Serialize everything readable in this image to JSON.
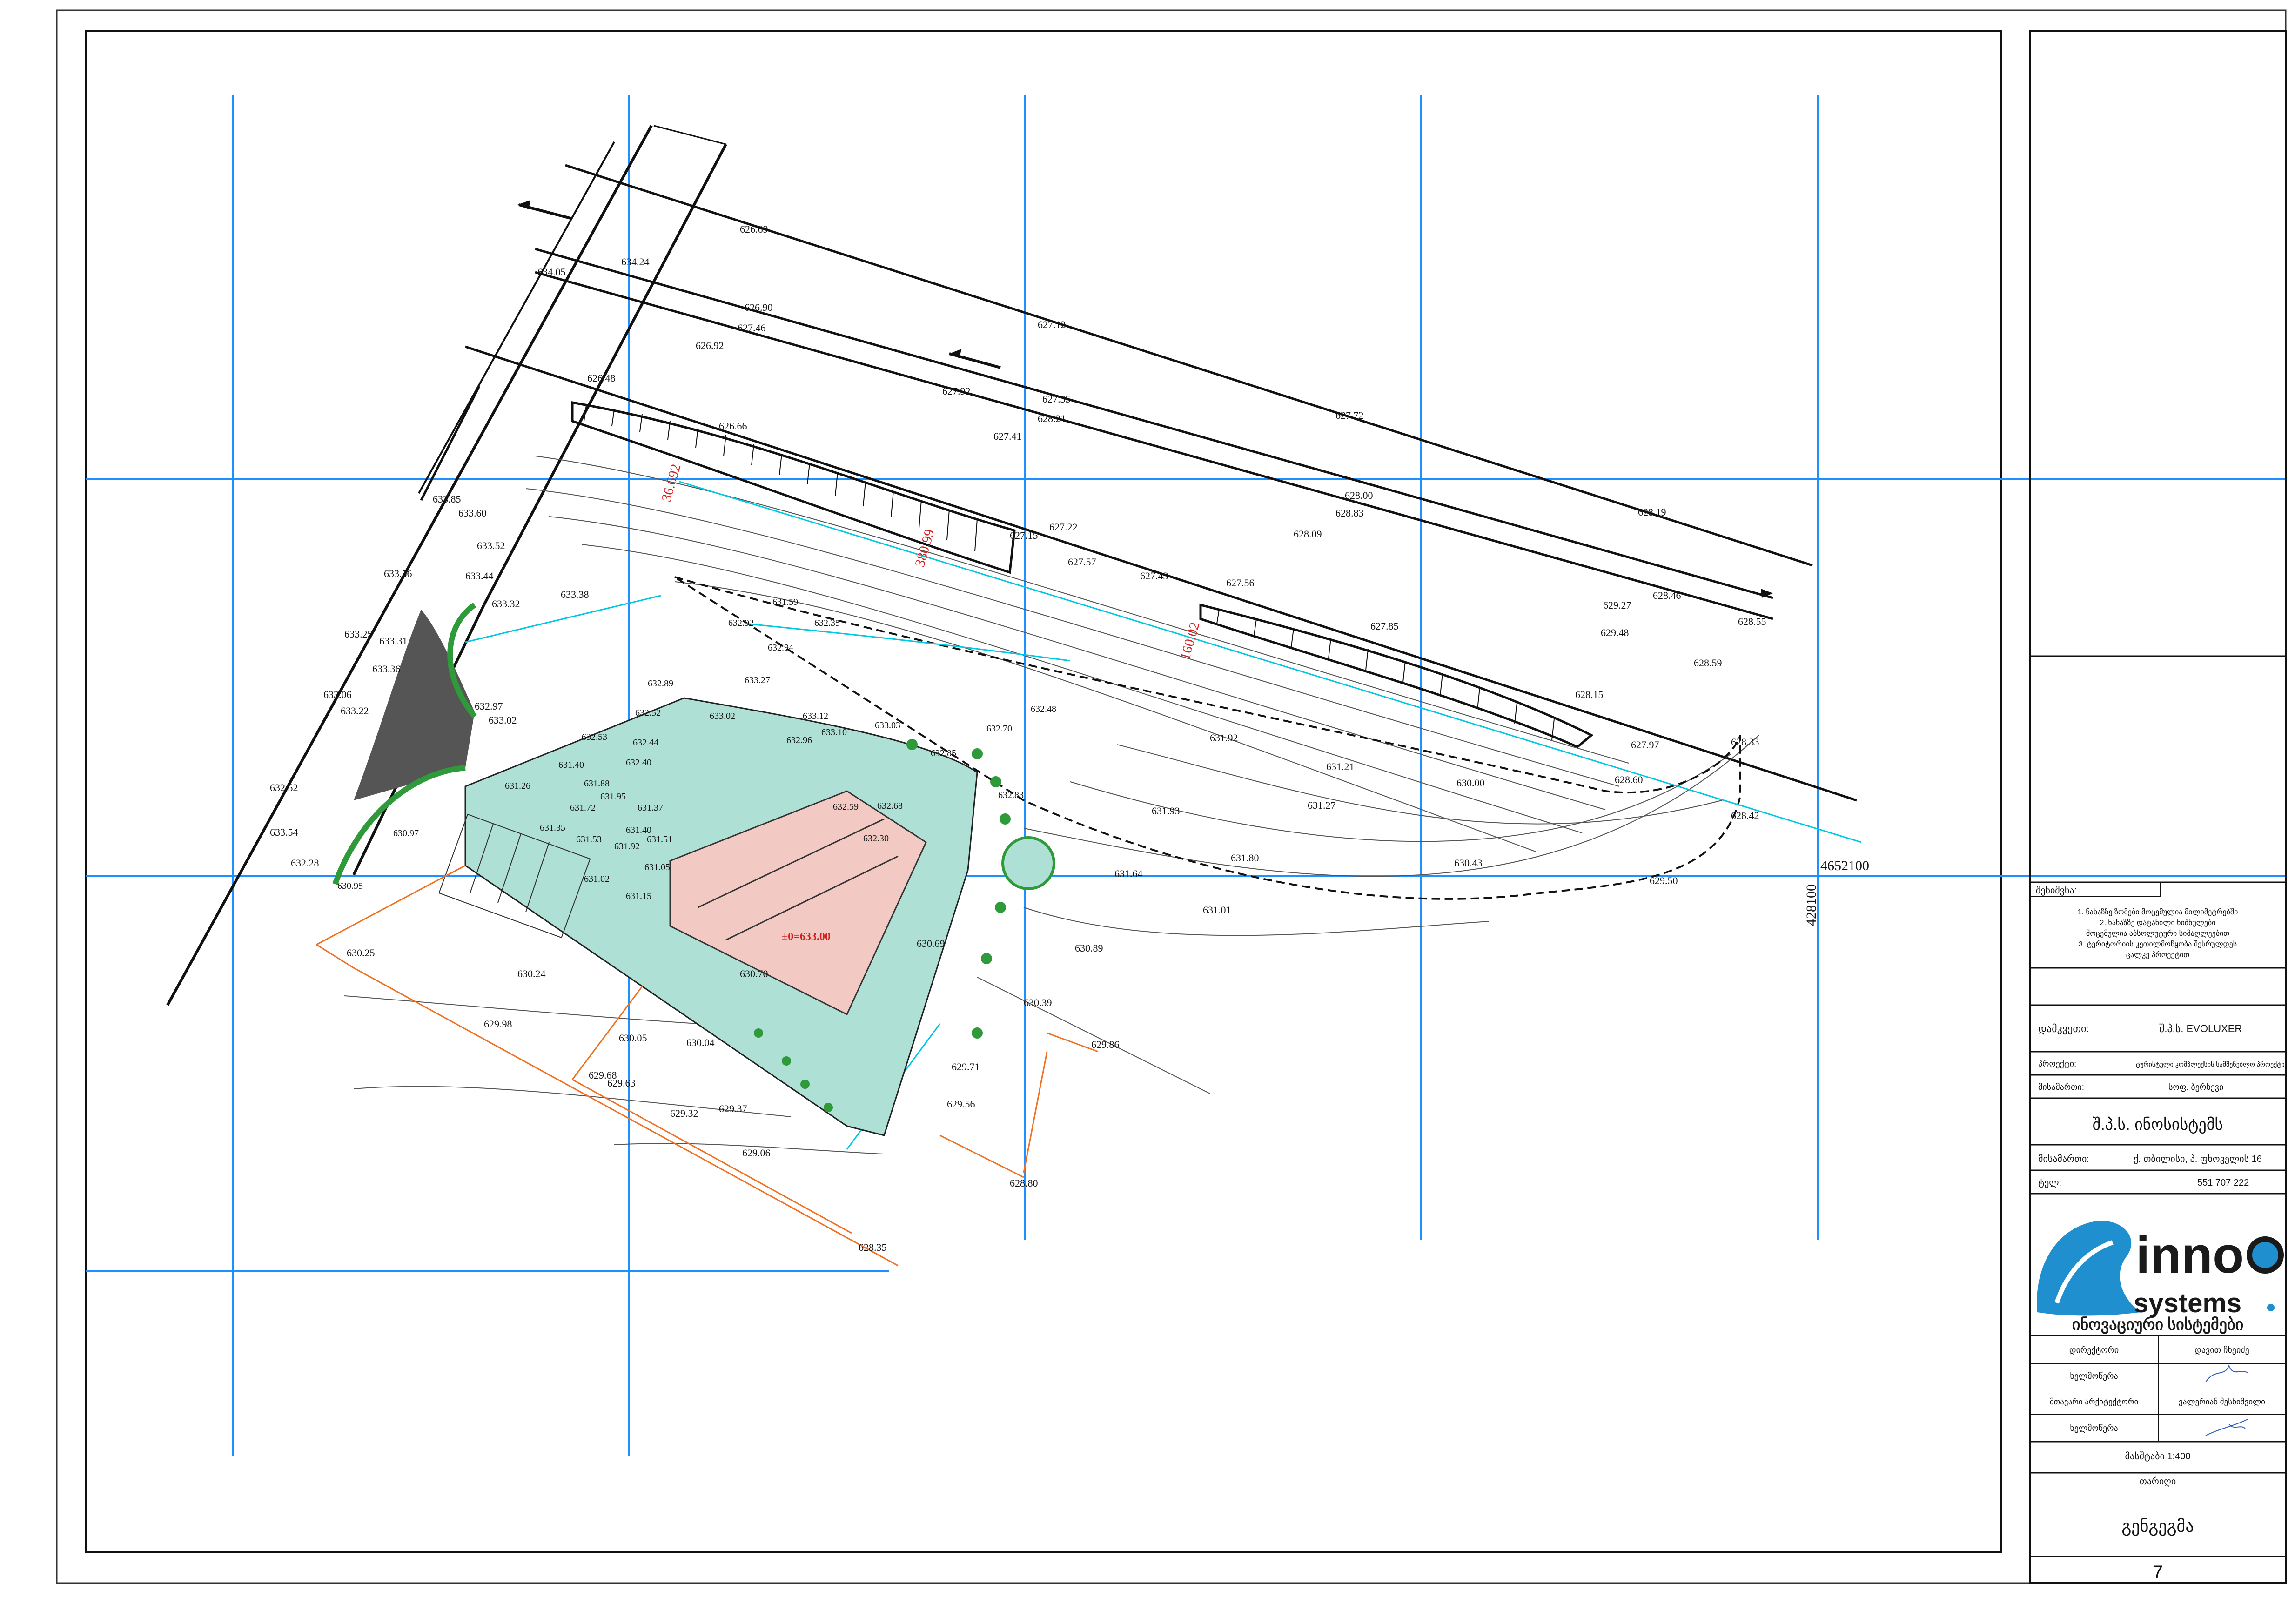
{
  "plan": {
    "coordinate_easting": "4652100",
    "coordinate_northing": "428100",
    "floor_level": "±0=633.00",
    "road_labels": [
      "380.99",
      "160.02",
      "36.692"
    ],
    "spot_levels": {
      "top": [
        "626.69",
        "626.90",
        "627.46",
        "626.92",
        "626.48",
        "627.12",
        "627.92",
        "627.35",
        "628.21",
        "627.41",
        "626.66",
        "627.72",
        "628.00",
        "628.83",
        "628.19",
        "628.09",
        "627.22",
        "627.15",
        "627.57",
        "627.43",
        "627.56",
        "629.27",
        "629.48",
        "628.46",
        "628.55",
        "628.59"
      ],
      "upper_left": [
        "634.05",
        "634.24",
        "633.85",
        "633.60",
        "633.52",
        "633.44",
        "633.56",
        "633.38",
        "633.32",
        "633.25",
        "633.31",
        "633.36",
        "633.06",
        "633.22",
        "632.97",
        "633.02",
        "632.52",
        "633.54",
        "632.28"
      ],
      "center": [
        "631.59",
        "632.92",
        "632.35",
        "632.94",
        "633.27",
        "633.12",
        "633.10",
        "633.03",
        "632.70",
        "632.48",
        "632.96",
        "632.85",
        "632.83",
        "632.68",
        "632.59",
        "632.30",
        "632.89",
        "633.02",
        "632.52",
        "632.53",
        "632.44",
        "632.40",
        "631.88",
        "631.40",
        "631.51",
        "631.72",
        "631.95",
        "631.37",
        "631.53",
        "631.92",
        "631.40",
        "631.05",
        "631.15",
        "631.02",
        "631.35",
        "631.26",
        "630.95",
        "630.97"
      ],
      "right": [
        "631.92",
        "631.21",
        "631.27",
        "630.00",
        "628.60",
        "628.15",
        "627.85",
        "627.97",
        "628.33",
        "628.42",
        "631.93",
        "631.80",
        "631.64",
        "631.01",
        "630.43",
        "629.50",
        "630.89",
        "630.39",
        "629.86",
        "629.71",
        "629.56",
        "628.80"
      ],
      "lower": [
        "630.25",
        "630.24",
        "630.70",
        "630.69",
        "630.04",
        "630.05",
        "629.98",
        "629.68",
        "629.63",
        "629.32",
        "629.37",
        "629.06",
        "628.35"
      ]
    }
  },
  "title_block": {
    "notes_label": "შენიშვნა:",
    "notes": [
      "1. ნახაზზე ზომები მოცემულია მილიმეტრებში",
      "2. ნახაზზე დატანილი ნიშნულები",
      "მოცემულია აბსოლუტური სიმაღლეებით",
      "3. ტერიტორიის კეთილმოწყობა შესრულდეს",
      "ცალკე პროექტით"
    ],
    "client_label": "დამკვეთი:",
    "client_value": "შ.პ.ს. EVOLUXER",
    "project_label": "პროექტი:",
    "project_value": "ტურისტული კომპლექსის სამშენებლო პროექტი",
    "address_label": "მისამართი:",
    "address_value": "სოფ. ბერხევი",
    "company_name": "შ.პ.ს. ინოსისტემს",
    "company_address_label": "მისამართი:",
    "company_address_value": "ქ. თბილისი, პ. ფხოველის 16",
    "phone_label": "ტელ:",
    "phone_value": "551 707 222",
    "logo_word": "inno",
    "logo_sub": "systems",
    "logo_caption": "ინოვაციური სისტემები",
    "director_label": "დირექტორი",
    "director_value": "დავით ჩხეიძე",
    "signature_label_1": "ხელმოწერა",
    "chief_architect_label": "მთავარი არქიტექტორი",
    "chief_architect_value": "ვალერიან მესხიშვილი",
    "signature_label_2": "ხელმოწერა",
    "scale": "მასშტაბი 1:400",
    "date_label": "თარიღი",
    "sheet_title": "გენგეგმა",
    "sheet_number": "7"
  },
  "colors": {
    "grid": "#1e90ff",
    "building_fill": "#aee0d6",
    "green": "#2e9a3a",
    "asphalt": "#555555",
    "dimension": "#f07020",
    "level_red": "#d42020",
    "cyan": "#00c8e0"
  }
}
